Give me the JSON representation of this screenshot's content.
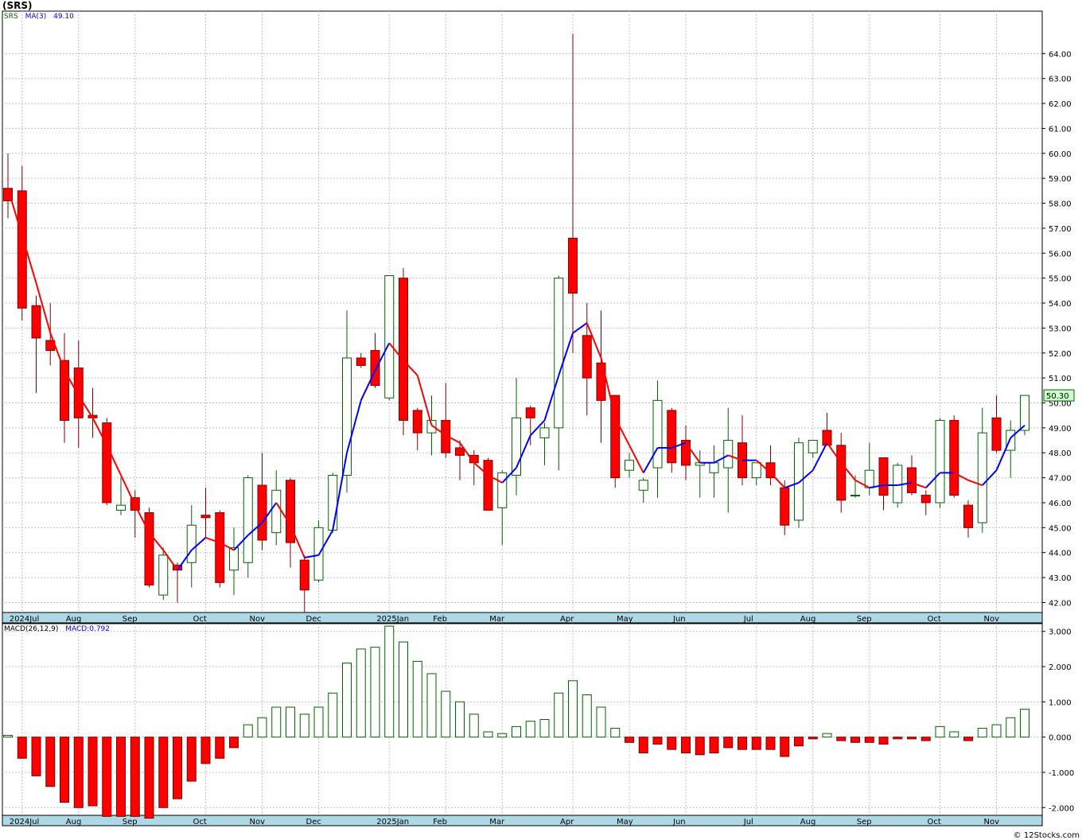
{
  "title": "(SRS)",
  "legend_main": {
    "symbol": "SRS",
    "ma_label": "MA(3)",
    "ma_value": "49.10"
  },
  "legend_macd": {
    "label": "MACD(26,12,9)",
    "value_label": "MACD:0.792"
  },
  "copyright": "© 12Stocks.com",
  "colors": {
    "up": "#006400",
    "down": "#ff0000",
    "ma_up": "#0000ff",
    "ma_down": "#ff0000",
    "axis_bg": "#add8e6",
    "grid": "#c0c0c0"
  },
  "chart_data": [
    {
      "type": "candlestick",
      "title": "(SRS)",
      "ylim": [
        41.6,
        65.7
      ],
      "yticks": [
        42,
        43,
        44,
        45,
        46,
        47,
        48,
        49,
        50,
        51,
        52,
        53,
        54,
        55,
        56,
        57,
        58,
        59,
        60,
        61,
        62,
        63,
        64
      ],
      "ytick_labels": [
        "42.00",
        "43.00",
        "44.00",
        "45.00",
        "46.00",
        "47.00",
        "48.00",
        "49.00",
        "50.00",
        "51.00",
        "52.00",
        "53.00",
        "54.00",
        "55.00",
        "56.00",
        "57.00",
        "58.00",
        "59.00",
        "60.00",
        "61.00",
        "62.00",
        "63.00",
        "64.00"
      ],
      "last_price_label": "50.30",
      "month_labels": [
        {
          "idx": 1,
          "label": "2024Jul"
        },
        {
          "idx": 5,
          "label": "Aug"
        },
        {
          "idx": 9,
          "label": "Sep"
        },
        {
          "idx": 14,
          "label": "Oct"
        },
        {
          "idx": 18,
          "label": "Nov"
        },
        {
          "idx": 22,
          "label": "Dec"
        },
        {
          "idx": 27,
          "label": "2025Jan"
        },
        {
          "idx": 31,
          "label": "Feb"
        },
        {
          "idx": 35,
          "label": "Mar"
        },
        {
          "idx": 40,
          "label": "Apr"
        },
        {
          "idx": 44,
          "label": "May"
        },
        {
          "idx": 48,
          "label": "Jun"
        },
        {
          "idx": 53,
          "label": "Jul"
        },
        {
          "idx": 57,
          "label": "Aug"
        },
        {
          "idx": 61,
          "label": "Sep"
        },
        {
          "idx": 66,
          "label": "Oct"
        },
        {
          "idx": 70,
          "label": "Nov"
        }
      ],
      "grid": true,
      "candles": [
        [
          58.6,
          60.0,
          57.4,
          58.1
        ],
        [
          58.5,
          59.5,
          53.3,
          53.8
        ],
        [
          53.9,
          54.3,
          50.4,
          52.6
        ],
        [
          52.5,
          54.0,
          51.5,
          52.1
        ],
        [
          51.7,
          52.8,
          48.4,
          49.3
        ],
        [
          51.4,
          52.5,
          48.2,
          49.4
        ],
        [
          49.5,
          50.6,
          48.6,
          49.4
        ],
        [
          49.2,
          49.4,
          45.9,
          46.0
        ],
        [
          45.7,
          47.0,
          45.5,
          45.9
        ],
        [
          46.2,
          46.5,
          44.6,
          45.7
        ],
        [
          45.6,
          45.8,
          42.6,
          42.7
        ],
        [
          42.3,
          44.2,
          42.1,
          43.9
        ],
        [
          43.5,
          43.6,
          42.0,
          43.3
        ],
        [
          43.6,
          45.9,
          42.6,
          45.1
        ],
        [
          45.5,
          46.6,
          44.6,
          45.4
        ],
        [
          45.6,
          45.7,
          42.6,
          42.8
        ],
        [
          43.3,
          45.0,
          42.3,
          44.2
        ],
        [
          43.6,
          47.1,
          43.0,
          47.0
        ],
        [
          46.7,
          48.0,
          44.1,
          44.5
        ],
        [
          44.8,
          47.3,
          44.3,
          46.5
        ],
        [
          46.9,
          47.0,
          43.4,
          44.4
        ],
        [
          43.7,
          43.9,
          41.6,
          42.5
        ],
        [
          42.9,
          45.3,
          42.8,
          45.0
        ],
        [
          44.9,
          47.2,
          44.8,
          47.1
        ],
        [
          47.1,
          53.7,
          46.4,
          51.8
        ],
        [
          51.8,
          52.0,
          51.4,
          51.5
        ],
        [
          52.1,
          52.8,
          50.6,
          50.7
        ],
        [
          50.2,
          55.1,
          50.1,
          55.1
        ],
        [
          55.0,
          55.4,
          48.7,
          49.3
        ],
        [
          49.7,
          49.8,
          48.1,
          48.8
        ],
        [
          48.8,
          50.3,
          47.9,
          49.3
        ],
        [
          49.3,
          50.8,
          47.8,
          48.0
        ],
        [
          48.2,
          48.5,
          46.9,
          47.9
        ],
        [
          47.9,
          48.1,
          46.7,
          47.6
        ],
        [
          47.7,
          47.8,
          45.7,
          45.7
        ],
        [
          45.8,
          47.3,
          44.3,
          47.2
        ],
        [
          47.1,
          51.0,
          46.3,
          49.4
        ],
        [
          49.8,
          49.9,
          48.3,
          49.4
        ],
        [
          48.6,
          49.2,
          47.5,
          49.0
        ],
        [
          49.0,
          55.1,
          47.3,
          55.0
        ],
        [
          56.6,
          64.8,
          52.0,
          54.4
        ],
        [
          52.7,
          54.0,
          49.5,
          51.0
        ],
        [
          51.6,
          53.7,
          48.4,
          50.1
        ],
        [
          50.3,
          50.3,
          46.6,
          47.0
        ],
        [
          47.3,
          48.0,
          47.0,
          47.7
        ],
        [
          46.5,
          47.0,
          46.0,
          46.9
        ],
        [
          47.4,
          50.9,
          46.2,
          50.1
        ],
        [
          49.7,
          49.8,
          47.2,
          47.6
        ],
        [
          48.5,
          49.1,
          46.9,
          47.5
        ],
        [
          47.5,
          48.1,
          46.2,
          47.6
        ],
        [
          47.2,
          48.3,
          46.2,
          47.6
        ],
        [
          47.4,
          49.8,
          45.6,
          48.5
        ],
        [
          48.4,
          49.5,
          46.7,
          47.0
        ],
        [
          47.0,
          47.4,
          46.7,
          47.6
        ],
        [
          47.6,
          48.3,
          46.7,
          47.0
        ],
        [
          46.6,
          46.9,
          44.7,
          45.1
        ],
        [
          45.3,
          48.6,
          45.0,
          48.4
        ],
        [
          48.0,
          48.3,
          47.8,
          48.5
        ],
        [
          48.9,
          49.6,
          48.3,
          48.3
        ],
        [
          48.3,
          48.8,
          45.6,
          46.1
        ],
        [
          46.3,
          47.1,
          46.2,
          46.3
        ],
        [
          46.6,
          48.4,
          46.3,
          47.3
        ],
        [
          47.8,
          47.8,
          45.7,
          46.3
        ],
        [
          46.0,
          47.6,
          45.8,
          47.5
        ],
        [
          47.4,
          47.9,
          46.3,
          46.4
        ],
        [
          46.3,
          46.5,
          45.5,
          46.0
        ],
        [
          46.0,
          49.4,
          45.8,
          49.3
        ],
        [
          49.3,
          49.5,
          46.2,
          46.3
        ],
        [
          45.9,
          46.1,
          44.6,
          45.0
        ],
        [
          45.2,
          49.8,
          44.8,
          48.8
        ],
        [
          49.4,
          50.3,
          48.0,
          48.1
        ],
        [
          48.1,
          49.3,
          47.0,
          48.9
        ],
        [
          48.9,
          50.3,
          48.7,
          50.3
        ]
      ],
      "ma3": [
        58.6,
        56.7,
        54.8,
        52.8,
        51.3,
        50.3,
        49.4,
        48.3,
        47.1,
        45.9,
        44.8,
        44.1,
        43.3,
        44.1,
        44.6,
        44.4,
        44.1,
        44.7,
        45.2,
        46.0,
        45.1,
        43.8,
        43.9,
        44.9,
        48.0,
        50.1,
        51.3,
        52.4,
        51.7,
        51.1,
        49.1,
        48.7,
        48.4,
        47.6,
        47.1,
        46.8,
        47.4,
        48.7,
        49.3,
        51.1,
        52.8,
        53.2,
        51.8,
        49.4,
        48.3,
        47.2,
        48.2,
        48.2,
        48.4,
        47.6,
        47.6,
        47.9,
        47.7,
        47.7,
        47.2,
        46.6,
        46.8,
        47.3,
        48.4,
        47.6,
        46.9,
        46.6,
        46.7,
        46.7,
        46.8,
        46.6,
        47.2,
        47.2,
        46.9,
        46.7,
        47.3,
        48.6,
        49.1
      ],
      "ma_label": "MA(3)",
      "ma_last": "49.10"
    },
    {
      "type": "bar",
      "title": "MACD(26,12,9)",
      "ylim": [
        -2.22,
        3.22
      ],
      "yticks": [
        -2,
        -1,
        0,
        1,
        2,
        3
      ],
      "ytick_labels": [
        "-2.000",
        "-1.000",
        "0.000",
        "1.000",
        "2.000",
        "3.000"
      ],
      "values": [
        0.05,
        -0.6,
        -1.1,
        -1.4,
        -1.85,
        -2.0,
        -1.95,
        -2.25,
        -2.25,
        -2.25,
        -2.3,
        -2.0,
        -1.75,
        -1.25,
        -0.75,
        -0.6,
        -0.3,
        0.35,
        0.55,
        0.85,
        0.85,
        0.65,
        0.85,
        1.25,
        2.1,
        2.5,
        2.55,
        3.15,
        2.7,
        2.15,
        1.8,
        1.3,
        1.0,
        0.65,
        0.15,
        0.1,
        0.3,
        0.45,
        0.5,
        1.25,
        1.6,
        1.2,
        0.85,
        0.25,
        -0.15,
        -0.45,
        -0.2,
        -0.35,
        -0.45,
        -0.5,
        -0.45,
        -0.3,
        -0.35,
        -0.35,
        -0.35,
        -0.55,
        -0.25,
        -0.05,
        0.1,
        -0.1,
        -0.15,
        -0.15,
        -0.2,
        -0.05,
        -0.05,
        -0.1,
        0.3,
        0.15,
        -0.1,
        0.25,
        0.35,
        0.55,
        0.79
      ],
      "value_label": "MACD:0.792"
    }
  ]
}
